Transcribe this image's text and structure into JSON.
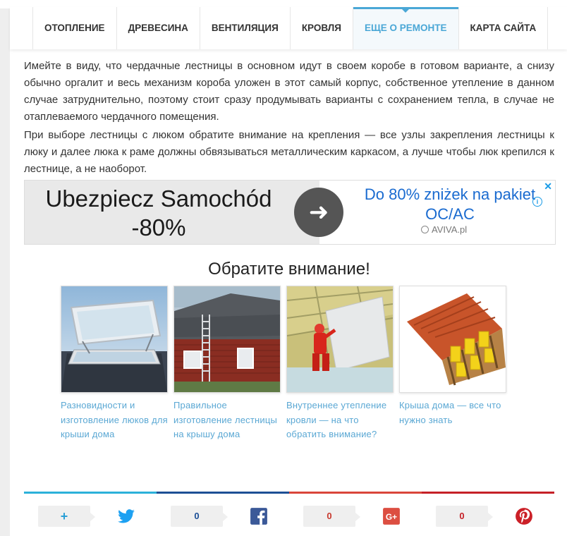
{
  "nav": {
    "items": [
      {
        "label": "ОТОПЛЕНИЕ"
      },
      {
        "label": "ДРЕВЕСИНА"
      },
      {
        "label": "ВЕНТИЛЯЦИЯ"
      },
      {
        "label": "КРОВЛЯ"
      },
      {
        "label": "ЕЩЕ О РЕМОНТЕ",
        "active": true
      },
      {
        "label": "КАРТА САЙТА"
      }
    ]
  },
  "article": {
    "paragraph_1": "Имейте в виду, что чердачные лестницы в основном идут в своем коробе в готовом варианте, а снизу обычно оргалит и весь механизм короба уложен в этот самый корпус, собственное утепление в данном случае затруднительно, поэтому стоит сразу продумывать варианты с сохранением тепла, в случае не отаплеваемого чердачного помещения.",
    "paragraph_2": "При выборе лестницы с люком обратите внимание на крепления — все узлы закрепления лестницы к люку и далее люка к раме должны обвязываться металлическим каркасом, а лучше чтобы люк крепился к лестнице, а не наоборот."
  },
  "ad": {
    "headline_line1": "Ubezpiecz Samochód",
    "headline_line2": "-80%",
    "offer_line1": "Do 80% zniżek na pakiet",
    "offer_line2": "OC/AC",
    "brand": "AVIVA.pl",
    "info_glyph": "i",
    "close_glyph": "✕",
    "arrow_glyph": "➜"
  },
  "related": {
    "heading": "Обратите внимание!",
    "cards": [
      {
        "title": "Разновидности и изготовление люков для крыши дома",
        "image": "roof-hatch-photo"
      },
      {
        "title": "Правильное изготовление лестницы на крышу дома",
        "image": "house-ladder-photo"
      },
      {
        "title": "Внутреннее утепление кровли — на что обратить внимание?",
        "image": "insulation-worker-photo"
      },
      {
        "title": "Крыша дома — все что нужно знать",
        "image": "roof-structure-illustration"
      }
    ]
  },
  "share": {
    "rule_colors": [
      "#2bb1d9",
      "#1d4f95",
      "#d9453a",
      "#c52027"
    ],
    "buttons": [
      {
        "network": "plus",
        "count": "+",
        "icon": "twitter-icon",
        "color": "#1da1f2"
      },
      {
        "network": "facebook",
        "count": "0",
        "icon": "facebook-icon",
        "color": "#3b5998"
      },
      {
        "network": "google-plus",
        "count": "0",
        "icon": "google-plus-icon",
        "color": "#dc4e41"
      },
      {
        "network": "pinterest",
        "count": "0",
        "icon": "pinterest-icon",
        "color": "#cb2027"
      }
    ]
  }
}
